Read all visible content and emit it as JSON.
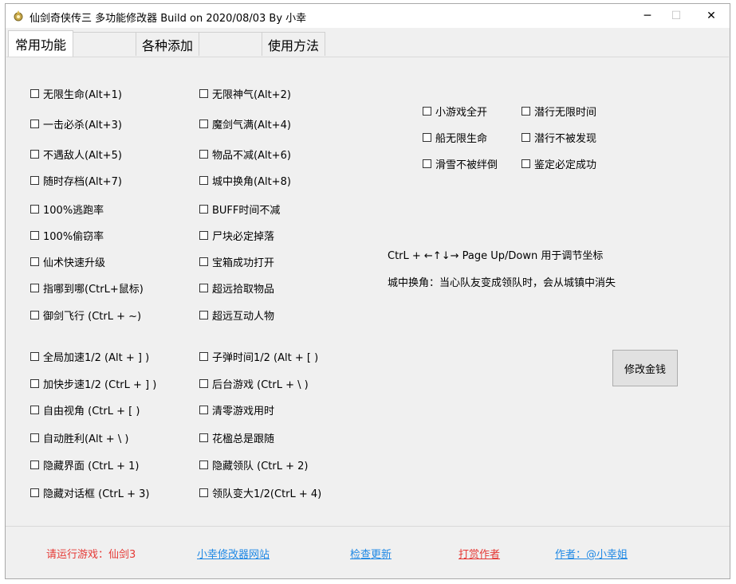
{
  "window": {
    "title": "仙剑奇侠传三 多功能修改器 Build on 2020/08/03 By 小幸",
    "icon": "app-gear-icon",
    "minimize_glyph": "─",
    "maximize_glyph": "☐",
    "close_glyph": "✕"
  },
  "tabs": [
    "常用功能",
    "各种添加",
    "使用方法"
  ],
  "left_col": [
    "无限生命(Alt+1)",
    "一击必杀(Alt+3)",
    "不遇敌人(Alt+5)",
    "随时存档(Alt+7)",
    "100%逃跑率",
    "100%偷窃率",
    "仙术快速升级",
    "指哪到哪(CtrL+鼠标)",
    "御剑飞行 (CtrL + ~)",
    "全局加速1/2 (Alt + ] )",
    "加快步速1/2 (CtrL + ] )",
    "自由视角 (CtrL + [ )",
    "自动胜利(Alt + \\ )",
    "隐藏界面 (CtrL + 1)",
    "隐藏对话框 (CtrL + 3)"
  ],
  "mid_col": [
    "无限神气(Alt+2)",
    "魔剑气满(Alt+4)",
    "物品不减(Alt+6)",
    "城中换角(Alt+8)",
    "BUFF时间不减",
    "尸块必定掉落",
    "宝箱成功打开",
    "超远拾取物品",
    "超远互动人物",
    "子弹时间1/2 (Alt + [ )",
    "后台游戏 (CtrL + \\ )",
    "清零游戏用时",
    "花楹总是跟随",
    "隐藏领队 (CtrL + 2)",
    "领队变大1/2(CtrL + 4)"
  ],
  "right_group": [
    [
      "小游戏全开",
      "潜行无限时间"
    ],
    [
      "船无限生命",
      "潜行不被发现"
    ],
    [
      "滑雪不被绊倒",
      "鉴定必定成功"
    ]
  ],
  "info": {
    "line1": "CtrL + ←↑↓→ Page Up/Down 用于调节坐标",
    "line2": "城中换角：当心队友变成领队时，会从城镇中消失"
  },
  "money_button": "修改金钱",
  "footer": {
    "status": "请运行游戏：仙剑3",
    "site": "小幸修改器网站",
    "update": "检查更新",
    "donate": "打赏作者",
    "author": "作者：@小幸姐"
  },
  "colors": {
    "link_blue": "#1e88e5",
    "warn_red": "#e53935"
  }
}
